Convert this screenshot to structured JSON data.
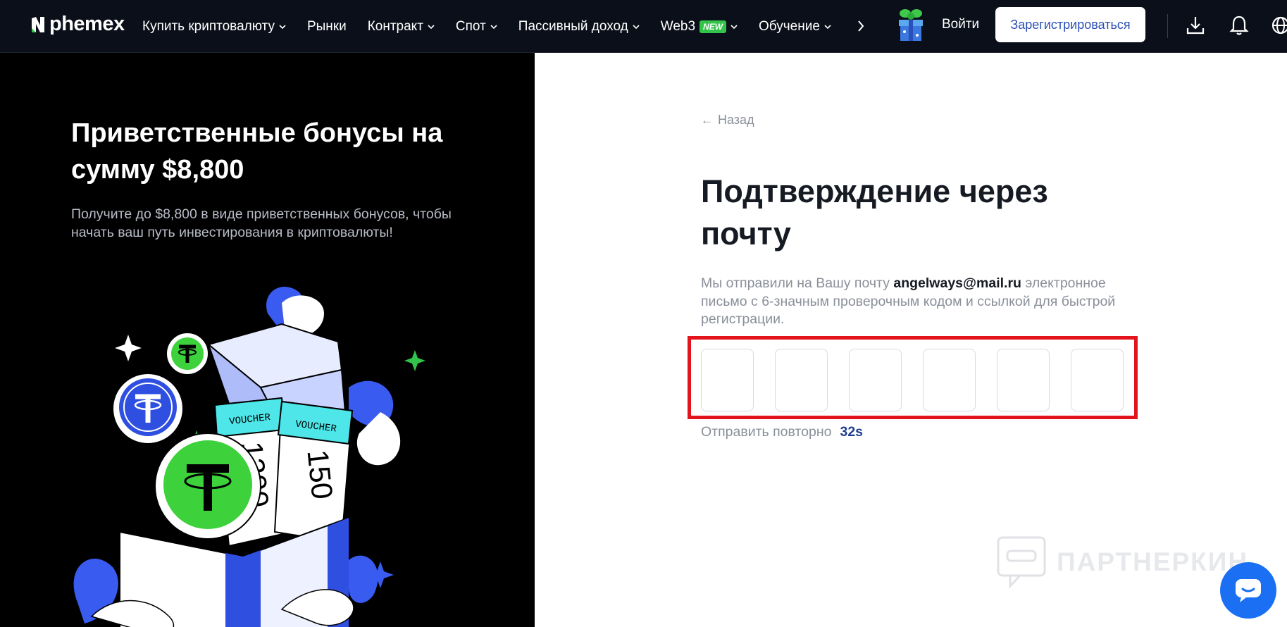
{
  "nav": {
    "logo_text": "phemex",
    "items": [
      {
        "label": "Купить криптовалюту",
        "has_dropdown": true
      },
      {
        "label": "Рынки",
        "has_dropdown": false
      },
      {
        "label": "Контракт",
        "has_dropdown": true
      },
      {
        "label": "Спот",
        "has_dropdown": true
      },
      {
        "label": "Пассивный доход",
        "has_dropdown": true
      },
      {
        "label": "Web3",
        "badge": "NEW",
        "has_dropdown": true
      },
      {
        "label": "Обучение",
        "has_dropdown": true
      }
    ],
    "login_label": "Войти",
    "register_label": "Зарегистрироваться"
  },
  "promo": {
    "title": "Приветственные бонусы на сумму $8,800",
    "subtitle": "Получите до $8,800 в виде приветственных бонусов, чтобы начать ваш путь инвестирования в криптовалюты!",
    "voucher_label": "VOUCHER",
    "voucher_values": [
      "1200",
      "150"
    ]
  },
  "form": {
    "back_label": "Назад",
    "title": "Подтверждение через почту",
    "desc_before": "Мы отправили на Вашу почту ",
    "email": "angelways@mail.ru",
    "desc_after": " электронное письмо с 6-значным проверочным кодом и ссылкой для быстрой регистрации.",
    "otp_values": [
      "",
      "",
      "",
      "",
      "",
      ""
    ],
    "resend_label": "Отправить повторно",
    "countdown": "32s"
  },
  "watermark": {
    "text": "ПАРТНЕРКИН"
  },
  "colors": {
    "nav_bg": "#0b0f19",
    "accent": "#2a4fb5",
    "new_badge": "#33c24a",
    "highlight": "#e3141b",
    "countdown": "#1f3d8f",
    "chat": "#1a6ff2",
    "tether_green": "#3dd13b",
    "promo_blue": "#2f4fe0"
  },
  "icons": [
    "chevron-down-icon",
    "chevron-right-icon",
    "gift-icon",
    "download-icon",
    "bell-icon",
    "globe-icon",
    "back-arrow-icon",
    "chat-icon"
  ]
}
